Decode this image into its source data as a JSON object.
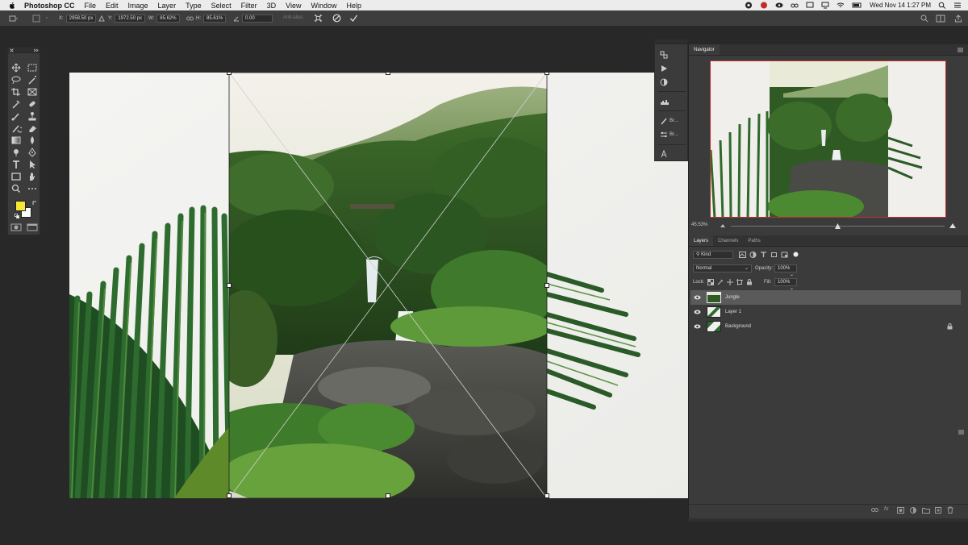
{
  "menubar": {
    "app_name": "Photoshop CC",
    "items": [
      "File",
      "Edit",
      "Image",
      "Layer",
      "Type",
      "Select",
      "Filter",
      "3D",
      "View",
      "Window",
      "Help"
    ],
    "datetime": "Wed Nov 14  1:27 PM",
    "status_icons": [
      "creative-cloud-icon",
      "record-icon",
      "eye-icon",
      "spectacles-icon",
      "screen-icon",
      "display-icon",
      "wifi-icon",
      "battery-icon",
      "search-icon",
      "list-icon"
    ]
  },
  "options_bar": {
    "x_label": "X:",
    "x_value": "2958.50 px",
    "y_label": "Y:",
    "y_value": "1972.50 px",
    "w_label": "W:",
    "w_value": "85.62%",
    "h_label": "H:",
    "h_value": "85.61%",
    "angle_value": "0.00",
    "interpolation_label": "Anti-alias"
  },
  "navigator": {
    "tab": "Navigator",
    "zoom": "45.53%",
    "zoom_slider_level": 0.5
  },
  "layers_panel": {
    "tabs": [
      "Layers",
      "Channels",
      "Paths"
    ],
    "filter_kind": "Kind",
    "blend_mode": "Normal",
    "opacity_label": "Opacity:",
    "opacity_value": "100%",
    "lock_label": "Lock:",
    "fill_label": "Fill:",
    "fill_value": "100%",
    "layers": [
      {
        "name": "Jungle",
        "visible": true,
        "selected": true,
        "locked": false
      },
      {
        "name": "Layer 1",
        "visible": true,
        "selected": false,
        "locked": false
      },
      {
        "name": "Background",
        "visible": true,
        "selected": false,
        "locked": true
      }
    ]
  },
  "mini_panel": {
    "items": [
      {
        "icon": "history-icon",
        "label": ""
      },
      {
        "icon": "play-actions-icon",
        "label": ""
      },
      {
        "icon": "adjustments-icon",
        "label": ""
      },
      {
        "icon": "histogram-icon",
        "label": ""
      },
      {
        "icon": "brush-icon",
        "label": "Br..."
      },
      {
        "icon": "brush-settings-icon",
        "label": "Br..."
      },
      {
        "icon": "character-icon",
        "label": ""
      }
    ]
  },
  "colors": {
    "foreground": "#f5e637",
    "background": "#ffffff",
    "panel_bg": "#3b3b3b",
    "workspace_bg": "#282828",
    "navigator_view_box": "#c0302c"
  }
}
